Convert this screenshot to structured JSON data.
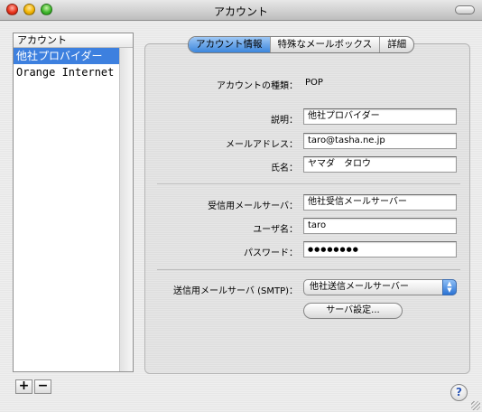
{
  "window": {
    "title": "アカウント"
  },
  "accounts": {
    "header": "アカウント",
    "items": [
      "他社プロバイダー",
      "Orange Internet"
    ],
    "selected_index": 0,
    "add_label": "+",
    "remove_label": "−"
  },
  "tabs": [
    "アカウント情報",
    "特殊なメールボックス",
    "詳細"
  ],
  "active_tab": "アカウント情報",
  "form": {
    "account_type_label": "アカウントの種類：",
    "account_type_value": "POP",
    "description_label": "説明：",
    "description_value": "他社プロバイダー",
    "email_label": "メールアドレス：",
    "email_value": "taro@tasha.ne.jp",
    "name_label": "氏名：",
    "name_value": "ヤマダ　タロウ",
    "incoming_label": "受信用メールサーバ：",
    "incoming_value": "他社受信メールサーバー",
    "username_label": "ユーザ名：",
    "username_value": "taro",
    "password_label": "パスワード：",
    "password_value": "●●●●●●●●",
    "smtp_label": "送信用メールサーバ (SMTP)：",
    "smtp_value": "他社送信メールサーバー",
    "server_settings_label": "サーバ設定..."
  },
  "help_label": "?",
  "colors": {
    "selection": "#3d80df",
    "tab_active": "#3b86dc"
  }
}
